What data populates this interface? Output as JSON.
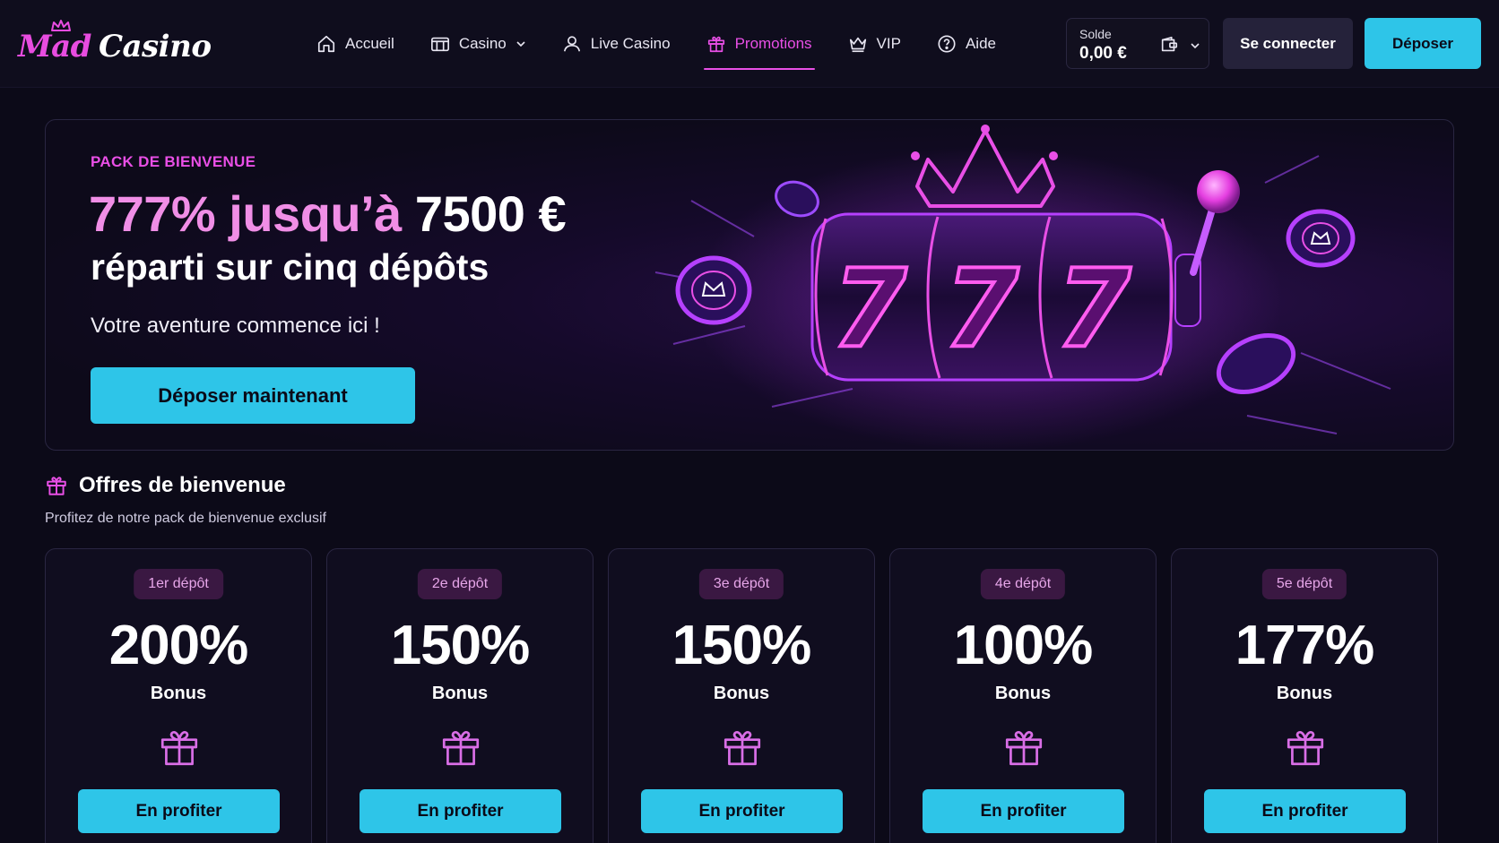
{
  "logo": {
    "part1": "Mad",
    "part2": "Casino"
  },
  "nav": {
    "items": [
      {
        "label": "Accueil",
        "icon": "home-icon"
      },
      {
        "label": "Casino",
        "icon": "slot-machine-icon",
        "dropdown": true
      },
      {
        "label": "Live Casino",
        "icon": "user-icon"
      },
      {
        "label": "Promotions",
        "icon": "gift-icon",
        "active": true
      },
      {
        "label": "VIP",
        "icon": "crown-icon"
      },
      {
        "label": "Aide",
        "icon": "help-circle-icon"
      }
    ]
  },
  "wallet": {
    "label": "Solde",
    "amount": "0,00 €"
  },
  "header": {
    "login_label": "Se connecter",
    "deposit_label": "Déposer"
  },
  "hero": {
    "eyebrow": "PACK DE BIENVENUE",
    "title_highlight": "777% jusqu’à",
    "title_amount": "7500 €",
    "subtitle": "réparti sur cinq dépôts",
    "tagline": "Votre aventure commence ici !",
    "cta_label": "Déposer maintenant"
  },
  "offers": {
    "title": "Offres de bienvenue",
    "subtitle": "Profitez de notre pack de bienvenue exclusif",
    "cards": [
      {
        "badge": "1er dépôt",
        "percent": "200%",
        "bonus_label": "Bonus",
        "cta": "En profiter"
      },
      {
        "badge": "2e dépôt",
        "percent": "150%",
        "bonus_label": "Bonus",
        "cta": "En profiter"
      },
      {
        "badge": "3e dépôt",
        "percent": "150%",
        "bonus_label": "Bonus",
        "cta": "En profiter"
      },
      {
        "badge": "4e dépôt",
        "percent": "100%",
        "bonus_label": "Bonus",
        "cta": "En profiter"
      },
      {
        "badge": "5e dépôt",
        "percent": "177%",
        "bonus_label": "Bonus",
        "cta": "En profiter"
      }
    ]
  },
  "colors": {
    "accent_cyan": "#2ec5e8",
    "accent_pink": "#e94fe6",
    "background": "#0c0a18"
  }
}
